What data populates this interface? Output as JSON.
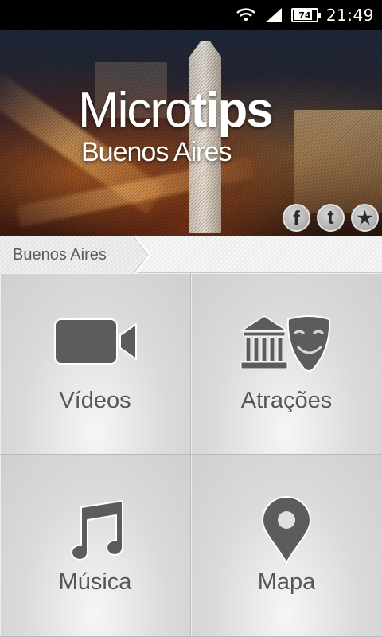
{
  "status_bar": {
    "time": "21:49",
    "battery": "74"
  },
  "banner": {
    "logo_light": "Micro",
    "logo_bold": "tips",
    "logo_city": "Buenos Aires",
    "social": [
      {
        "icon": "facebook-icon",
        "glyph": "f"
      },
      {
        "icon": "twitter-icon",
        "glyph": "t"
      },
      {
        "icon": "star-icon",
        "glyph": "★"
      }
    ]
  },
  "breadcrumb": {
    "label": "Buenos Aires"
  },
  "tiles": [
    {
      "label": "Vídeos",
      "icon": "video-camera-icon"
    },
    {
      "label": "Atrações",
      "icon": "attractions-icon"
    },
    {
      "label": "Música",
      "icon": "music-note-icon"
    },
    {
      "label": "Mapa",
      "icon": "map-pin-icon"
    }
  ],
  "colors": {
    "tile_text": "#575757",
    "icon_fill": "#5c5c5c",
    "status_bg": "#000000"
  }
}
